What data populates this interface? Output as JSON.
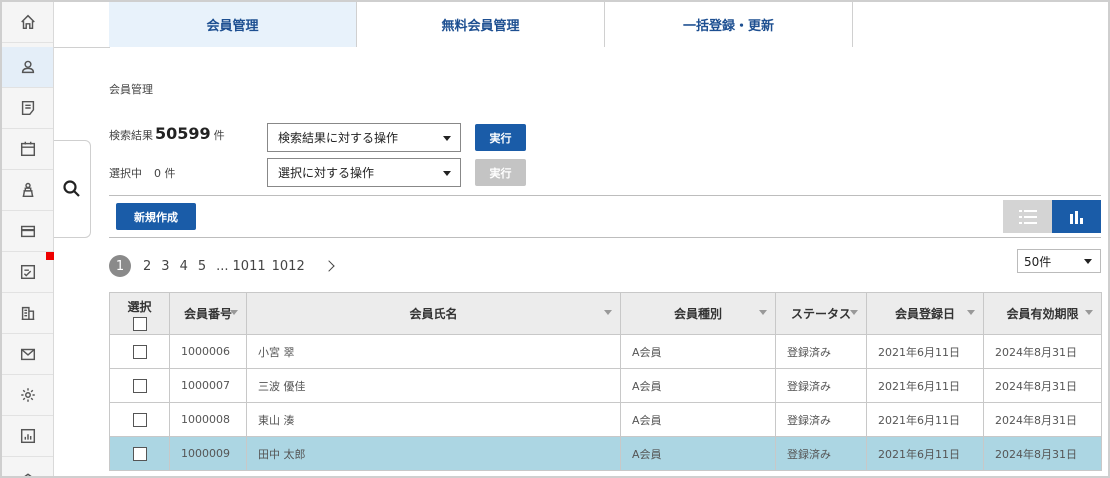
{
  "tabs": [
    {
      "label": "会員管理",
      "active": true
    },
    {
      "label": "無料会員管理",
      "active": false
    },
    {
      "label": "一括登録・更新",
      "active": false
    }
  ],
  "sidebar": {
    "items": [
      {
        "icon": "home-icon"
      },
      {
        "icon": "user-icon",
        "active": true
      },
      {
        "icon": "document-icon"
      },
      {
        "icon": "calendar-icon"
      },
      {
        "icon": "seat-icon"
      },
      {
        "icon": "credit-card-icon"
      },
      {
        "icon": "checklist-icon"
      },
      {
        "icon": "building-icon"
      },
      {
        "icon": "mail-icon"
      },
      {
        "icon": "gear-icon"
      },
      {
        "icon": "report-icon"
      },
      {
        "icon": "layers-icon"
      }
    ],
    "badge_color": "#e00000"
  },
  "page_title": "会員管理",
  "search": {
    "results_label": "検索結果",
    "results_count": "50599",
    "results_unit": "件",
    "results_action": "検索結果に対する操作",
    "selected_label": "選択中",
    "selected_count": "0 件",
    "selected_action": "選択に対する操作",
    "run_label": "実行",
    "run_disabled_label": "実行"
  },
  "toolbar": {
    "new_label": "新規作成"
  },
  "pagination": {
    "current": "1",
    "pages": [
      "2",
      "3",
      "4",
      "5"
    ],
    "ellipsis": "...",
    "last_pages": [
      "1011",
      "1012"
    ]
  },
  "per_page": "50件",
  "table": {
    "headers": [
      "選択",
      "会員番号",
      "会員氏名",
      "会員種別",
      "ステータス",
      "会員登録日",
      "会員有効期限"
    ],
    "rows": [
      {
        "id": "1000006",
        "name": "小宮 翠",
        "type": "A会員",
        "status": "登録済み",
        "registered": "2021年6月11日",
        "expires": "2024年8月31日",
        "selected": false
      },
      {
        "id": "1000007",
        "name": "三波 優佳",
        "type": "A会員",
        "status": "登録済み",
        "registered": "2021年6月11日",
        "expires": "2024年8月31日",
        "selected": false
      },
      {
        "id": "1000008",
        "name": "東山 湊",
        "type": "A会員",
        "status": "登録済み",
        "registered": "2021年6月11日",
        "expires": "2024年8月31日",
        "selected": false
      },
      {
        "id": "1000009",
        "name": "田中 太郎",
        "type": "A会員",
        "status": "登録済み",
        "registered": "2021年6月11日",
        "expires": "2024年8月31日",
        "selected": true
      }
    ]
  },
  "colors": {
    "accent": "#1a5ca8",
    "tab_active_bg": "#e8f2fb",
    "row_selected": "#acd6e3",
    "disabled": "#c4c4c4"
  }
}
